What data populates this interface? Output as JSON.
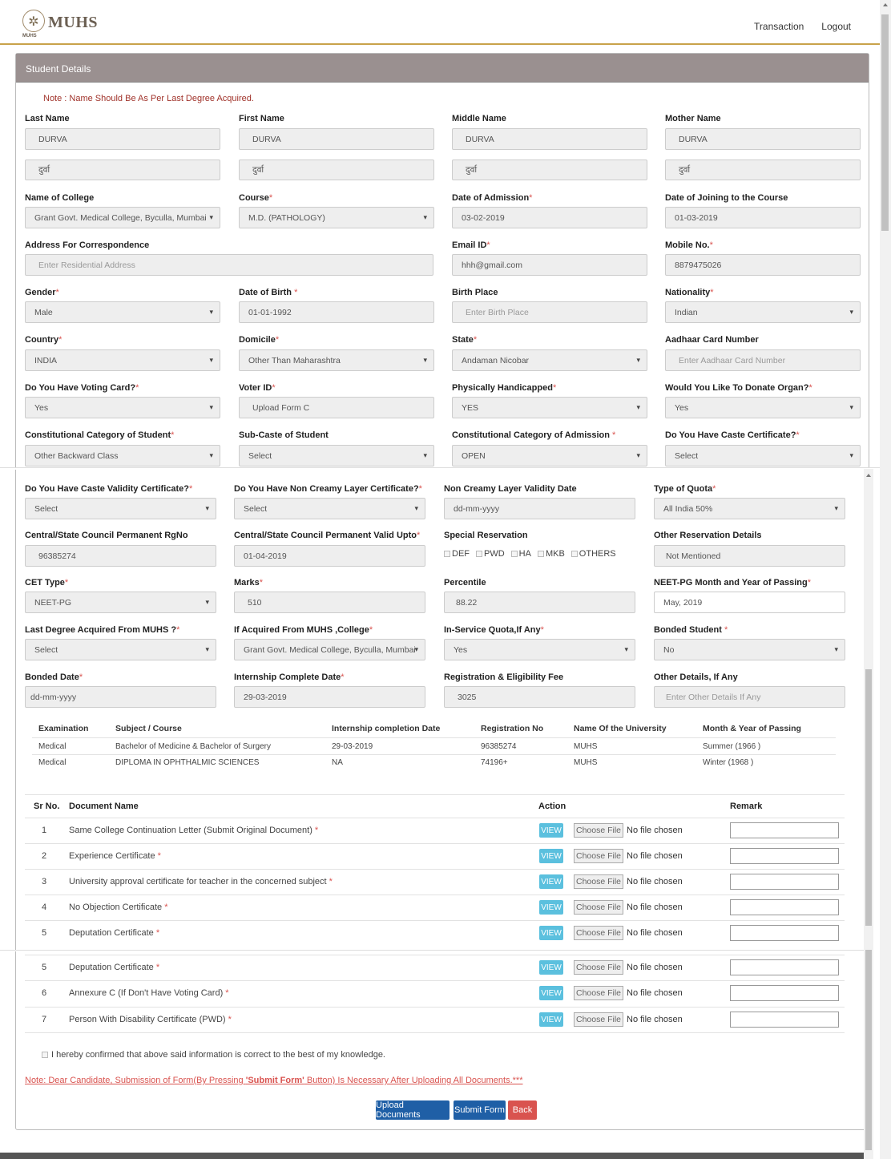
{
  "header": {
    "logo_text": "MUHS",
    "logo_sub": "MUHS",
    "nav": [
      "Transaction",
      "Logout"
    ]
  },
  "panel_title": "Student Details",
  "note": "Note : Name Should Be As Per Last Degree Acquired.",
  "name": {
    "labels": [
      "Last Name",
      "First Name",
      "Middle Name",
      "Mother Name"
    ],
    "values": [
      "DURVA",
      "DURVA",
      "DURVA",
      "DURVA"
    ],
    "devanagari": [
      "दुर्वा",
      "दुर्वा",
      "दुर्वा",
      "दुर्वा"
    ]
  },
  "fields": {
    "name_of_college": {
      "label": "Name of College",
      "value": "Grant Govt. Medical College, Byculla, Mumbai"
    },
    "course": {
      "label": "Course",
      "value": "M.D. (PATHOLOGY)"
    },
    "date_of_admission": {
      "label": "Date of Admission",
      "value": "03-02-2019"
    },
    "date_of_joining": {
      "label": "Date of Joining to the Course",
      "value": "01-03-2019"
    },
    "address": {
      "label": "Address For Correspondence",
      "placeholder": "Enter Residential Address"
    },
    "email": {
      "label": "Email ID",
      "value": "hhh@gmail.com"
    },
    "mobile": {
      "label": "Mobile No.",
      "value": "8879475026"
    },
    "gender": {
      "label": "Gender",
      "value": "Male"
    },
    "dob": {
      "label": "Date of Birth ",
      "value": "01-01-1992"
    },
    "birth_place": {
      "label": "Birth Place",
      "placeholder": "Enter Birth Place"
    },
    "nationality": {
      "label": "Nationality",
      "value": "Indian"
    },
    "country": {
      "label": "Country",
      "value": "INDIA"
    },
    "domicile": {
      "label": "Domicile",
      "value": "Other Than Maharashtra"
    },
    "state": {
      "label": "State",
      "value": "Andaman Nicobar"
    },
    "aadhaar": {
      "label": "Aadhaar Card Number",
      "placeholder": "Enter Aadhaar Card Number"
    },
    "voting_card": {
      "label": "Do You Have Voting Card?",
      "value": "Yes"
    },
    "voter_id": {
      "label": "Voter ID",
      "value": "Upload Form C"
    },
    "handicapped": {
      "label": "Physically Handicapped",
      "value": "YES"
    },
    "donate_organ": {
      "label": "Would You Like To Donate Organ?",
      "value": "Yes"
    },
    "const_cat_student": {
      "label": "Constitutional Category of Student",
      "value": "Other Backward Class"
    },
    "sub_caste": {
      "label": "Sub-Caste of Student",
      "value": "Select"
    },
    "const_cat_admission": {
      "label": "Constitutional Category of Admission ",
      "value": "OPEN"
    },
    "caste_cert": {
      "label": "Do You Have Caste Certificate?",
      "value": "Select"
    },
    "caste_validity": {
      "label": "Do You Have Caste Validity Certificate?",
      "value": "Select"
    },
    "non_creamy": {
      "label": "Do You Have Non Creamy Layer Certificate?",
      "value": "Select"
    },
    "non_creamy_date": {
      "label": "Non Creamy Layer Validity Date",
      "value": "dd-mm-yyyy"
    },
    "quota_type": {
      "label": "Type of Quota",
      "value": "All India 50%"
    },
    "council_rgno": {
      "label": "Central/State Council Permanent RgNo",
      "value": "96385274"
    },
    "council_valid": {
      "label": "Central/State Council Permanent Valid Upto",
      "value": "01-04-2019"
    },
    "special_res": {
      "label": "Special Reservation",
      "options": [
        "DEF",
        "PWD",
        "HA",
        "MKB",
        "OTHERS"
      ]
    },
    "other_res": {
      "label": "Other Reservation Details",
      "value": "Not Mentioned"
    },
    "cet_type": {
      "label": "CET Type",
      "value": "NEET-PG"
    },
    "marks": {
      "label": "Marks",
      "value": "510"
    },
    "percentile": {
      "label": "Percentile",
      "value": "88.22"
    },
    "neet_passing": {
      "label": "NEET-PG Month and Year of Passing",
      "value": "May, 2019"
    },
    "last_degree_muhs": {
      "label": "Last Degree Acquired From MUHS ?",
      "value": "Select"
    },
    "acquired_college": {
      "label": "If Acquired From MUHS ,College",
      "value": "Grant Govt. Medical College, Byculla, Mumbai"
    },
    "in_service": {
      "label": "In-Service Quota,If Any",
      "value": "Yes"
    },
    "bonded_student": {
      "label": "Bonded Student ",
      "value": "No"
    },
    "bonded_date": {
      "label": "Bonded Date",
      "value": "dd-mm-yyyy"
    },
    "internship_date": {
      "label": "Internship Complete Date",
      "value": "29-03-2019"
    },
    "reg_fee": {
      "label": "Registration & Eligibility Fee",
      "value": "3025"
    },
    "other_details": {
      "label": "Other Details, If Any",
      "placeholder": "Enter Other Details If Any"
    }
  },
  "exam_table": {
    "headers": [
      "Examination",
      "Subject / Course",
      "Internship completion Date",
      "Registration No",
      "Name Of the University",
      "Month & Year of Passing"
    ],
    "rows": [
      [
        "Medical",
        "Bachelor of Medicine & Bachelor of Surgery",
        "29-03-2019",
        "96385274",
        "MUHS",
        "Summer (1966 )"
      ],
      [
        "Medical",
        "DIPLOMA IN OPHTHALMIC SCIENCES",
        "NA",
        "74196+",
        "MUHS",
        "Winter (1968 )"
      ]
    ]
  },
  "docs": {
    "headers": [
      "Sr No.",
      "Document Name",
      "Action",
      "Remark"
    ],
    "view_label": "VIEW",
    "choose_label": "Choose File",
    "no_file": "No file chosen",
    "rows": [
      {
        "sr": "1",
        "name": "Same College Continuation Letter (Submit Original Document)"
      },
      {
        "sr": "2",
        "name": "Experience Certificate"
      },
      {
        "sr": "3",
        "name": "University approval certificate for teacher in the concerned subject"
      },
      {
        "sr": "4",
        "name": "No Objection Certificate"
      },
      {
        "sr": "5",
        "name": "Deputation Certificate"
      },
      {
        "sr": "5",
        "name": "Deputation Certificate"
      },
      {
        "sr": "6",
        "name": "Annexure C (If Don't Have Voting Card)"
      },
      {
        "sr": "7",
        "name": "Person With Disability Certificate (PWD)"
      }
    ]
  },
  "confirm_text": "I hereby confirmed that above said information is correct to the best of my knowledge.",
  "note2": {
    "pre": "Note: Dear Candidate, Submission of Form(By Pressing ",
    "bold": "'Submit Form'",
    "post": " Button) Is Necessary After Uploading All Documents.***"
  },
  "buttons": {
    "upload": "Upload Documents",
    "submit": "Submit Form",
    "back": "Back"
  },
  "colors": {
    "accent": "#c8a24a",
    "panel_header": "#9a9090",
    "view": "#5bc0de",
    "primary": "#1f5fa6",
    "danger": "#d9534f"
  }
}
